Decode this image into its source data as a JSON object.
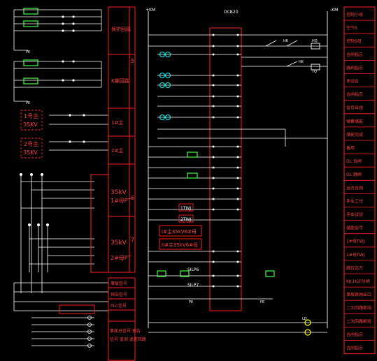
{
  "colors": {
    "background": "#000000",
    "wire": "#ffffff",
    "frame": "#ff2020",
    "label": "#ff4040",
    "device": "#40ff40",
    "node": "#00ffff",
    "yellow": "#ffff00"
  },
  "top_labels": {
    "left_bus": "+KM",
    "center_block": "DCB20",
    "right_bus": "-KM"
  },
  "left_panel": {
    "labels": [
      "1号主",
      "35KV",
      "2号主",
      "35KV",
      "PE",
      "PE"
    ],
    "pt_labels": [
      "35kV",
      "1#母PT",
      "35kV",
      "2#母PT"
    ],
    "section_numbers": [
      "5",
      "6",
      "7"
    ],
    "sections": [
      "保护回路",
      "K量回路",
      "1#主",
      "2#主"
    ],
    "bottom_boxes": [
      "事故信号",
      "预告信号",
      "PLC信号",
      "事故总信号  预告",
      "信号  遥测  遥信回路"
    ]
  },
  "right_column": {
    "labels": [
      "控制小母",
      "空气S",
      "控制S母",
      "合闸指示",
      "跳闸指示",
      "手动合",
      "合闸指示",
      "信号母线",
      "弹簧储能",
      "储能完成",
      "备用",
      "DL 合闸",
      "DL 跳闸",
      "远方合闸",
      "手车工作",
      "手车试验",
      "储能信号",
      "1#母TWJ",
      "2#母TWJ",
      "跳位远方",
      "KK,HCF分闸",
      "事故跳闸出口",
      "二次回路断线",
      "二次回路断线",
      "合闸指示",
      "合闸指示"
    ]
  },
  "center_panel": {
    "boxes": [
      "I#主35kV6#母",
      "II#主35kV6#母"
    ],
    "labels": [
      "1TWJ",
      "2TWJ",
      "SILP6",
      "SILP7",
      "HK",
      "HK",
      "TQ",
      "HQ",
      "LD",
      "PE",
      "PE"
    ]
  }
}
